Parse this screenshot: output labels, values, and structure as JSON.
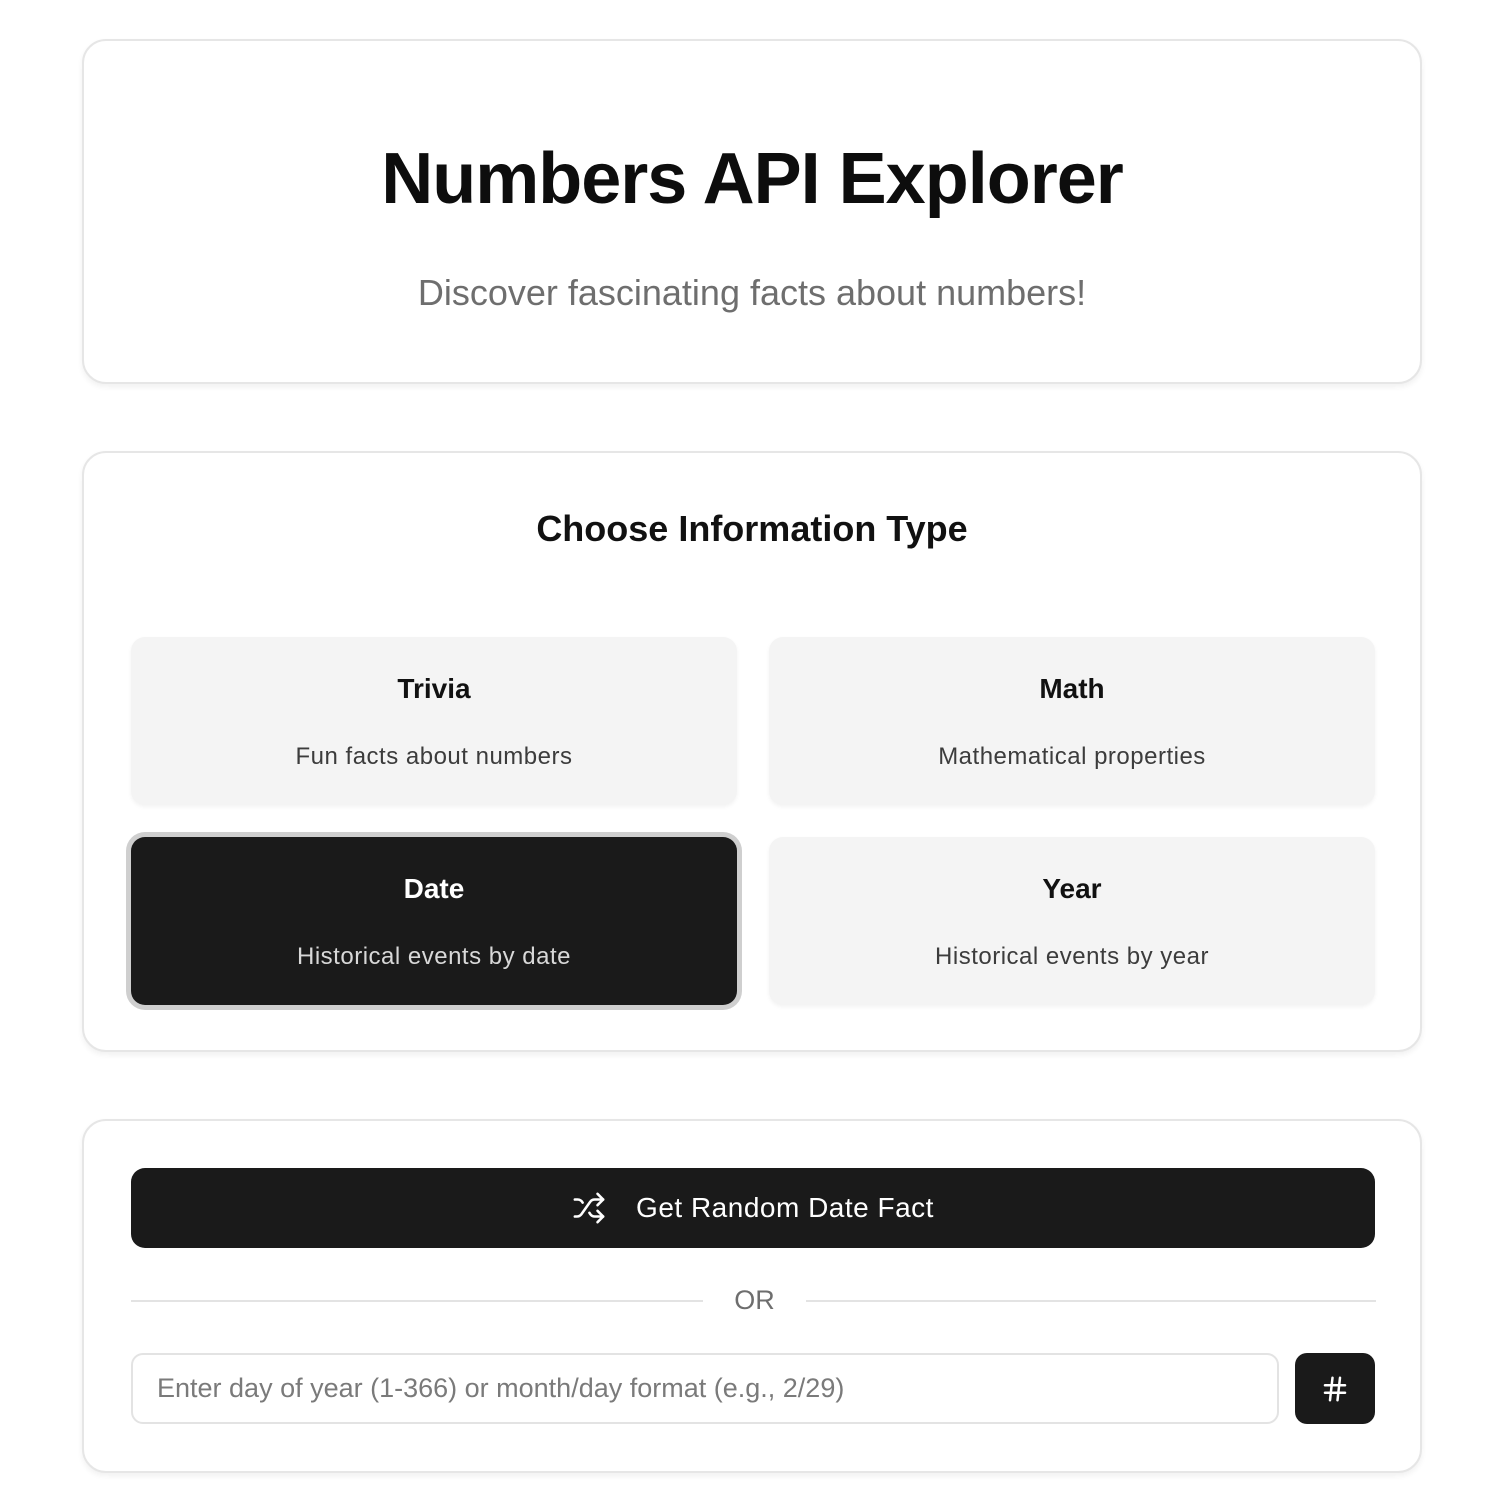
{
  "header": {
    "title": "Numbers API Explorer",
    "subtitle": "Discover fascinating facts about numbers!"
  },
  "type_selector": {
    "title": "Choose Information Type",
    "selected": "date",
    "options": [
      {
        "id": "trivia",
        "title": "Trivia",
        "description": "Fun facts about numbers"
      },
      {
        "id": "math",
        "title": "Math",
        "description": "Mathematical properties"
      },
      {
        "id": "date",
        "title": "Date",
        "description": "Historical events by date"
      },
      {
        "id": "year",
        "title": "Year",
        "description": "Historical events by year"
      }
    ]
  },
  "actions": {
    "random_button_label": "Get Random Date Fact",
    "random_button_icon": "shuffle-icon",
    "separator_text": "OR",
    "input": {
      "value": "",
      "placeholder": "Enter day of year (1-366) or month/day format (e.g., 2/29)"
    },
    "submit_icon": "hash-icon"
  },
  "colors": {
    "accent": "#1a1a1a",
    "card_border": "#e6e6e6",
    "option_bg": "#f4f4f4",
    "muted_text": "#6e6e6e"
  }
}
